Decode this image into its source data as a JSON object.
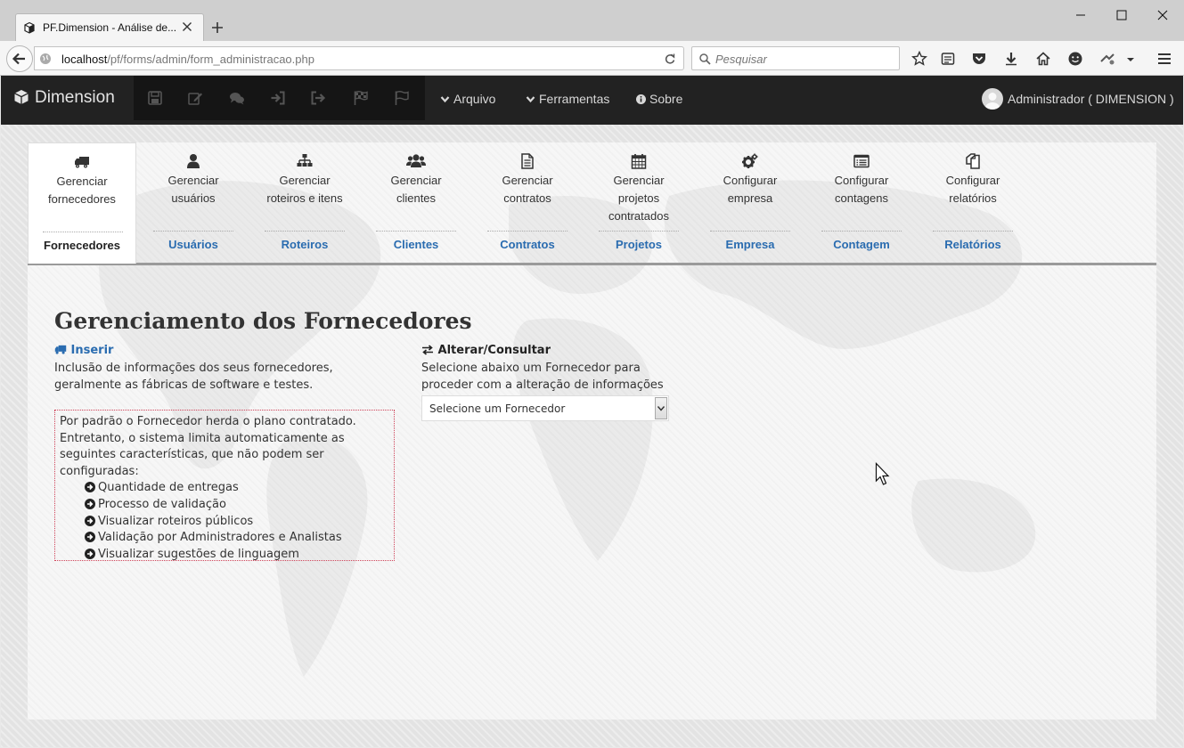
{
  "browser": {
    "tab_title": "PF.Dimension - Análise de...",
    "url_host": "localhost",
    "url_path": "/pf/forms/admin/form_administracao.php",
    "search_placeholder": "Pesquisar"
  },
  "app": {
    "brand": "Dimension",
    "menu": {
      "arquivo": "Arquivo",
      "ferramentas": "Ferramentas",
      "sobre": "Sobre"
    },
    "user": "Administrador ( DIMENSION )"
  },
  "tabs": [
    {
      "icon": "truck-icon",
      "desc_line1": "Gerenciar",
      "desc_line2": "fornecedores",
      "desc_line3": "",
      "label": "Fornecedores",
      "active": true
    },
    {
      "icon": "user-icon",
      "desc_line1": "Gerenciar",
      "desc_line2": "usuários",
      "desc_line3": "",
      "label": "Usuários",
      "active": false
    },
    {
      "icon": "sitemap-icon",
      "desc_line1": "Gerenciar",
      "desc_line2": "roteiros e itens",
      "desc_line3": "",
      "label": "Roteiros",
      "active": false
    },
    {
      "icon": "users-icon",
      "desc_line1": "Gerenciar",
      "desc_line2": "clientes",
      "desc_line3": "",
      "label": "Clientes",
      "active": false
    },
    {
      "icon": "file-icon",
      "desc_line1": "Gerenciar",
      "desc_line2": "contratos",
      "desc_line3": "",
      "label": "Contratos",
      "active": false
    },
    {
      "icon": "calendar-icon",
      "desc_line1": "Gerenciar",
      "desc_line2": "projetos",
      "desc_line3": "contratados",
      "label": "Projetos",
      "active": false
    },
    {
      "icon": "gears-icon",
      "desc_line1": "Configurar",
      "desc_line2": "empresa",
      "desc_line3": "",
      "label": "Empresa",
      "active": false
    },
    {
      "icon": "list-alt-icon",
      "desc_line1": "Configurar",
      "desc_line2": "contagens",
      "desc_line3": "",
      "label": "Contagem",
      "active": false
    },
    {
      "icon": "copy-icon",
      "desc_line1": "Configurar",
      "desc_line2": "relatórios",
      "desc_line3": "",
      "label": "Relatórios",
      "active": false
    }
  ],
  "main": {
    "title": "Gerenciamento dos Fornecedores",
    "insert_label": "Inserir",
    "insert_desc": "Inclusão de informações dos seus fornecedores, geralmente as fábricas de software e testes.",
    "notice_intro": "Por padrão o Fornecedor herda o plano contratado. Entretanto, o sistema limita automaticamente as seguintes características, que não podem ser configuradas:",
    "notice_items": [
      "Quantidade de entregas",
      "Processo de validação",
      "Visualizar roteiros públicos",
      "Validação por Administradores e Analistas",
      "Visualizar sugestões de linguagem"
    ],
    "alter_title": "Alterar/Consultar",
    "alter_desc": "Selecione abaixo um Fornecedor para proceder com a alteração de informações",
    "select_value": "Selecione um Fornecedor"
  },
  "colors": {
    "link": "#2a6cb0",
    "appbar": "#222222",
    "notice_border": "#d0445a"
  }
}
